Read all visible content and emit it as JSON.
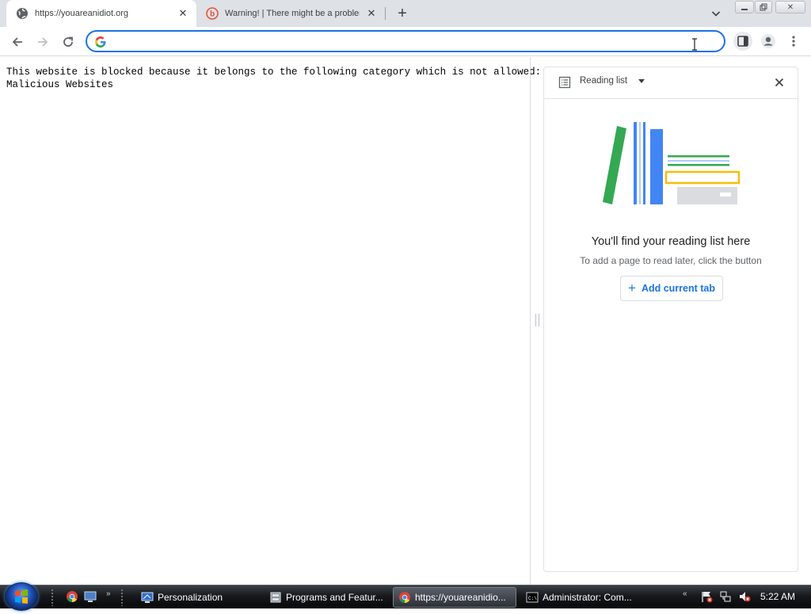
{
  "colors": {
    "accent": "#1a73e8",
    "tabstrip": "#dee1e6",
    "taskbar": "#1b1d20"
  },
  "tabs": [
    {
      "title": "https://youareanidiot.org",
      "icon": "globe-icon",
      "active": true
    },
    {
      "title": "Warning! | There might be a problem",
      "icon": "bitdefender-icon",
      "active": false
    }
  ],
  "toolbar": {
    "address_value": "",
    "address_placeholder": ""
  },
  "page": {
    "blocked_line1": "This website is blocked because it belongs to the following category which is not allowed:",
    "blocked_line2": "Malicious Websites"
  },
  "side_panel": {
    "title": "Reading list",
    "empty_title": "You'll find your reading list here",
    "empty_subtitle": "To add a page to read later, click the button",
    "add_button_label": "Add current tab"
  },
  "taskbar": {
    "items": [
      {
        "label": "Personalization",
        "icon": "personalization-icon",
        "active": false
      },
      {
        "label": "Programs and Featur...",
        "icon": "programs-icon",
        "active": false
      },
      {
        "label": "https://youareanidio...",
        "icon": "chrome-icon",
        "active": true
      },
      {
        "label": "Administrator:  Com...",
        "icon": "cmd-icon",
        "active": false
      }
    ],
    "clock": "5:22 AM"
  }
}
